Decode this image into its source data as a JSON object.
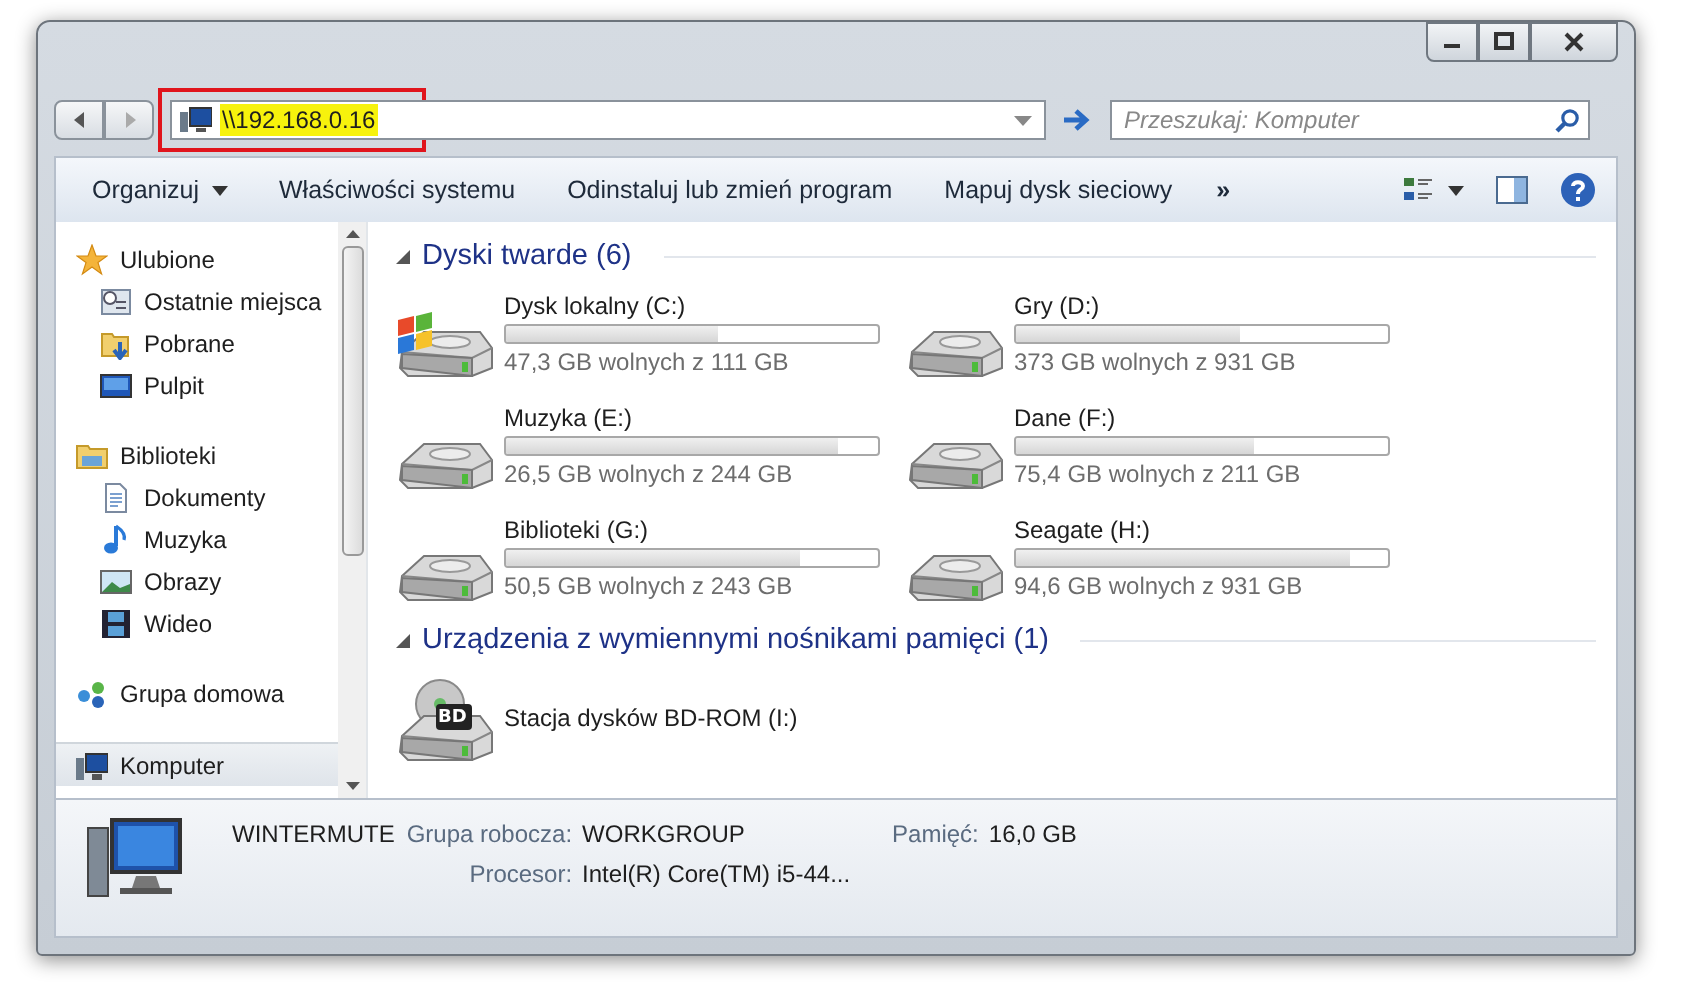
{
  "address": {
    "value": "\\\\192.168.0.16",
    "highlighted": true
  },
  "search": {
    "placeholder": "Przeszukaj: Komputer"
  },
  "toolbar": [
    {
      "label": "Organizuj",
      "kind": "menu"
    },
    {
      "label": "Właściwości systemu",
      "kind": "button"
    },
    {
      "label": "Odinstaluj lub zmień program",
      "kind": "button"
    },
    {
      "label": "Mapuj dysk sieciowy",
      "kind": "button"
    },
    {
      "label": "»",
      "kind": "more"
    }
  ],
  "sidebar": {
    "items": [
      {
        "label": "Ulubione",
        "selected": false,
        "children": [
          {
            "label": "Ostatnie miejsca",
            "selected": false
          },
          {
            "label": "Pobrane",
            "selected": false
          },
          {
            "label": "Pulpit",
            "selected": false
          }
        ]
      },
      {
        "label": "Biblioteki",
        "selected": false,
        "children": [
          {
            "label": "Dokumenty",
            "selected": false
          },
          {
            "label": "Muzyka",
            "selected": false
          },
          {
            "label": "Obrazy",
            "selected": false
          },
          {
            "label": "Wideo",
            "selected": false
          }
        ]
      },
      {
        "label": "Grupa domowa",
        "selected": false
      },
      {
        "label": "Komputer",
        "selected": true
      }
    ]
  },
  "groups": [
    {
      "title": "Dyski twarde (6)",
      "expanded": true,
      "items": [
        {
          "name": "Dysk lokalny (C:)",
          "kind": "system",
          "level": 0.57,
          "free": "47,3 GB wolnych z 111 GB"
        },
        {
          "name": "Gry (D:)",
          "kind": "disk",
          "level": 0.6,
          "free": "373 GB wolnych z 931 GB"
        },
        {
          "name": "Muzyka (E:)",
          "kind": "disk",
          "level": 0.89,
          "free": "26,5 GB wolnych z 244 GB"
        },
        {
          "name": "Dane (F:)",
          "kind": "disk",
          "level": 0.64,
          "free": "75,4 GB wolnych z 211 GB"
        },
        {
          "name": "Biblioteki (G:)",
          "kind": "disk",
          "level": 0.79,
          "free": "50,5 GB wolnych z 243 GB"
        },
        {
          "name": "Seagate (H:)",
          "kind": "disk",
          "level": 0.9,
          "free": "94,6 GB wolnych z 931 GB"
        }
      ]
    },
    {
      "title": "Urządzenia z wymiennymi nośnikami pamięci (1)",
      "expanded": true,
      "items": [
        {
          "name": "Stacja dysków BD-ROM (I:)",
          "kind": "optical",
          "badge": "BD"
        }
      ]
    }
  ],
  "details": {
    "name": "WINTERMUTE",
    "fields": [
      {
        "label": "Grupa robocza:",
        "value": "WORKGROUP"
      },
      {
        "label": "Pamięć:",
        "value": "16,0 GB"
      },
      {
        "label": "Procesor:",
        "value": "Intel(R) Core(TM) i5-44..."
      }
    ]
  }
}
